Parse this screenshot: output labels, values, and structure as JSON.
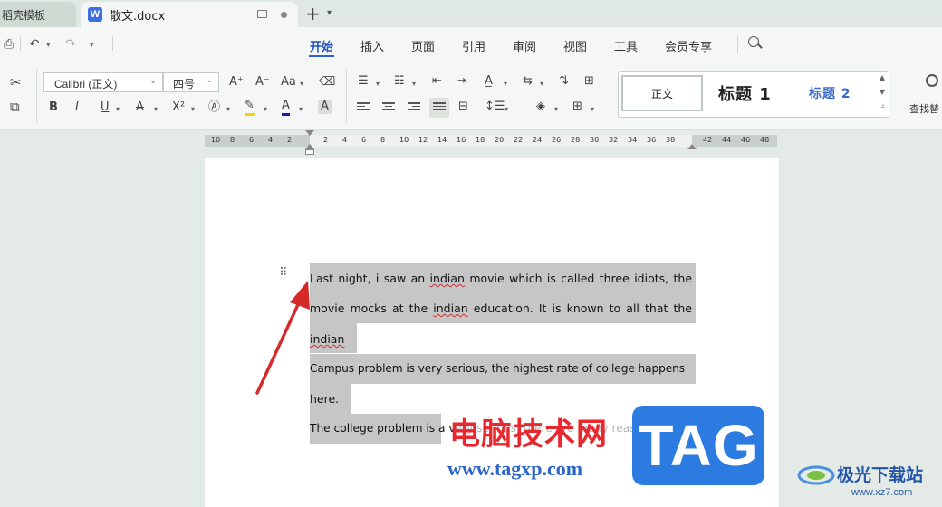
{
  "tabs": [
    {
      "label": "稻壳模板",
      "active": false
    },
    {
      "label": "散文.docx",
      "active": true
    }
  ],
  "app_logo_letter": "W",
  "menu": [
    {
      "label": "开始",
      "active": true
    },
    {
      "label": "插入"
    },
    {
      "label": "页面"
    },
    {
      "label": "引用"
    },
    {
      "label": "审阅"
    },
    {
      "label": "视图"
    },
    {
      "label": "工具"
    },
    {
      "label": "会员专享"
    }
  ],
  "ribbon": {
    "font_name": "Calibri (正文)",
    "font_size": "四号",
    "styles": {
      "normal": "正文",
      "heading1": "标题  1",
      "heading2": "标题  2"
    },
    "find_replace": "查找替"
  },
  "ruler": {
    "left_numbers": [
      "10",
      "8",
      "6",
      "4",
      "2"
    ],
    "right_numbers": [
      "2",
      "4",
      "6",
      "8",
      "10",
      "12",
      "14",
      "16",
      "18",
      "20",
      "22",
      "24",
      "26",
      "28",
      "30",
      "32",
      "34",
      "36",
      "38"
    ],
    "outer_numbers": [
      "42",
      "44",
      "46",
      "48"
    ]
  },
  "document": {
    "line1": {
      "pre": "Last night, i saw an ",
      "word": "indian",
      "post": " movie which is called three idiots, the"
    },
    "line2": {
      "pre": "movie mocks at the ",
      "word": "indian",
      "post": " education. It is known to all that the"
    },
    "line3": {
      "word": "indian"
    },
    "line4": "Campus problem is very serious, the highest rate of college happens",
    "line5": "here.",
    "line6_visible": "The college problem is a v",
    "line6_faint": "ery serious, there are many reasons."
  },
  "watermark": {
    "cn": "电脑技术网",
    "url": "www.tagxp.com",
    "tag": "TAG",
    "site_cn": "极光下载站",
    "site_url": "www.xz7.com"
  },
  "colors": {
    "accent": "#2b5de0",
    "selection": "#c6c6c6",
    "watermark_red": "#e8282f",
    "tag_blue": "#2c7be0",
    "arrow": "#d42a2a"
  }
}
